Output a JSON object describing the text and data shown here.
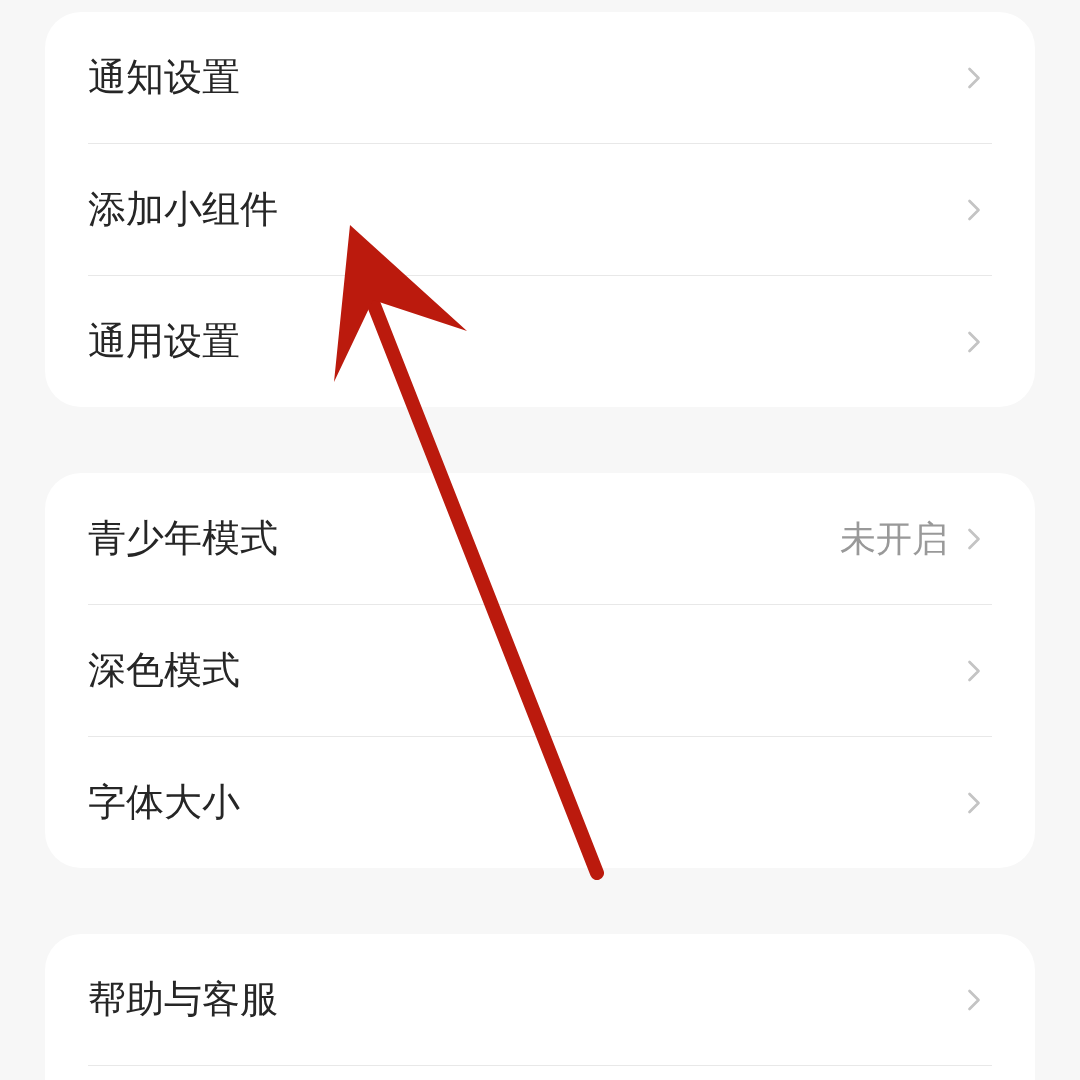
{
  "sections": [
    {
      "items": [
        {
          "label": "通知设置"
        },
        {
          "label": "添加小组件"
        },
        {
          "label": "通用设置"
        }
      ]
    },
    {
      "items": [
        {
          "label": "青少年模式",
          "value": "未开启"
        },
        {
          "label": "深色模式"
        },
        {
          "label": "字体大小"
        }
      ]
    },
    {
      "items": [
        {
          "label": "帮助与客服"
        }
      ]
    }
  ]
}
